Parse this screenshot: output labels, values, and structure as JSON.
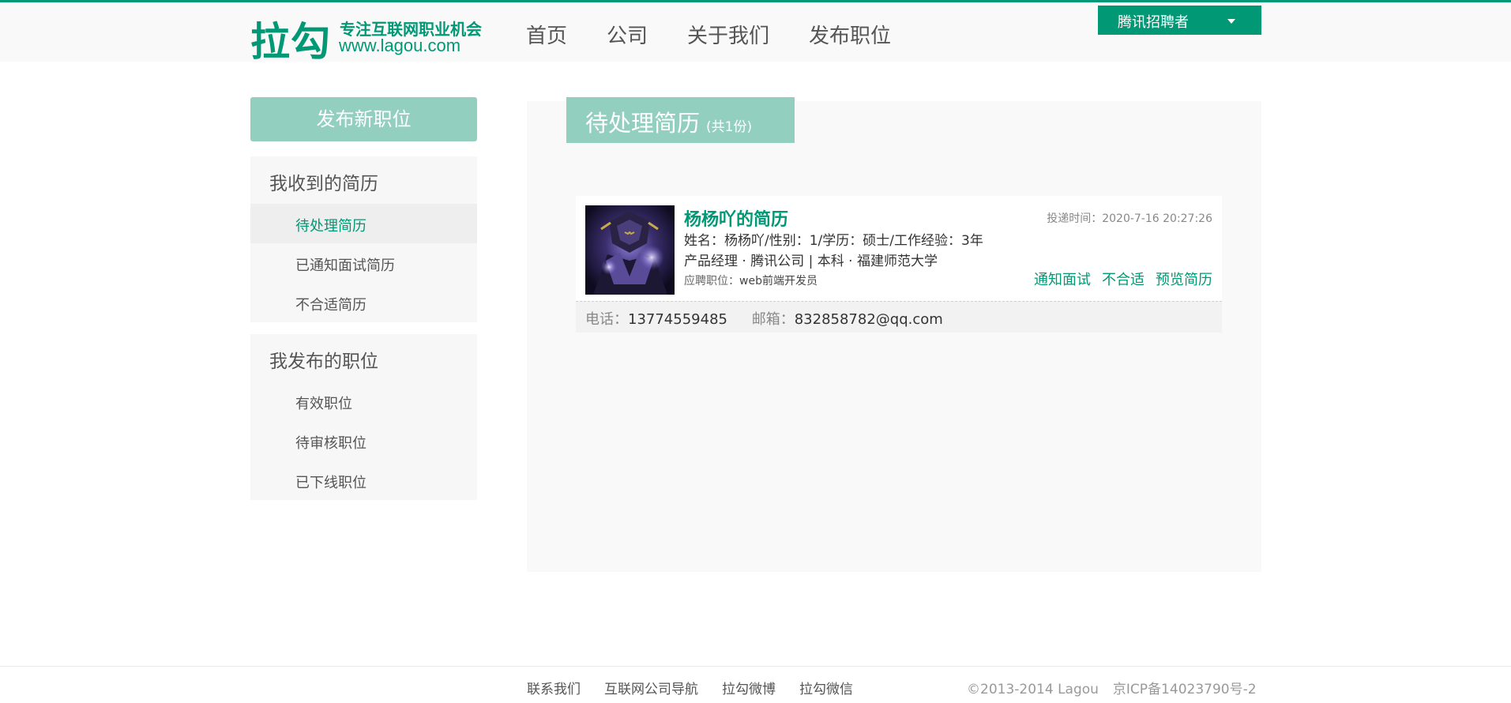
{
  "header": {
    "logo": {
      "big": "拉勾",
      "slogan": "专注互联网职业机会",
      "url": "www.lagou.com"
    },
    "nav": [
      "首页",
      "公司",
      "关于我们",
      "发布职位"
    ],
    "user_menu": "腾讯招聘者"
  },
  "sidebar": {
    "post_button": "发布新职位",
    "groups": [
      {
        "title": "我收到的简历",
        "items": [
          "待处理简历",
          "已通知面试简历",
          "不合适简历"
        ],
        "active": 0
      },
      {
        "title": "我发布的职位",
        "items": [
          "有效职位",
          "待审核职位",
          "已下线职位"
        ]
      }
    ]
  },
  "main": {
    "tab_title": "待处理简历",
    "tab_count": "(共1份)",
    "resume": {
      "name": "杨杨吖的简历",
      "info": "姓名：杨杨吖/性别：1/学历：硕士/工作经验：3年",
      "edu": "产品经理 · 腾讯公司 | 本科 · 福建师范大学",
      "apply_label": "应聘职位：",
      "apply_job": "web前端开发员",
      "time_label": "投递时间：",
      "time": "2020-7-16 20:27:26",
      "actions": [
        "通知面试",
        "不合适",
        "预览简历"
      ],
      "phone_label": "电话：",
      "phone": "13774559485",
      "email_label": "邮箱：",
      "email": "832858782@qq.com"
    }
  },
  "footer": {
    "links": [
      "联系我们",
      "互联网公司导航",
      "拉勾微博",
      "拉勾微信"
    ],
    "copyright": "©2013-2014 Lagou",
    "icp": "京ICP备14023790号-2"
  },
  "colors": {
    "brand": "#019875",
    "brand_light": "#93cfbf"
  }
}
